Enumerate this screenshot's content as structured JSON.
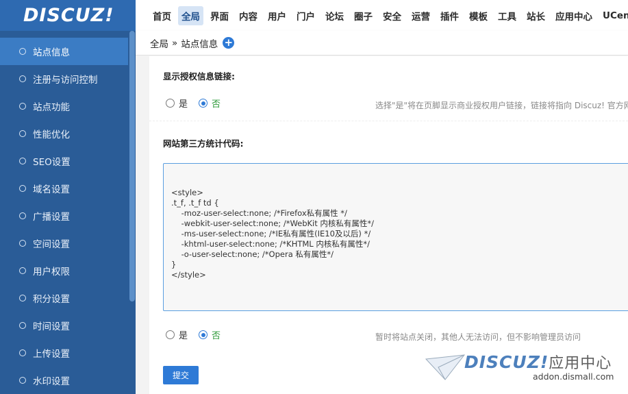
{
  "header": {
    "logo_text": "DISCUZ!",
    "nav": [
      "首页",
      "全局",
      "界面",
      "内容",
      "用户",
      "门户",
      "论坛",
      "圈子",
      "安全",
      "运营",
      "插件",
      "模板",
      "工具",
      "站长",
      "应用中心",
      "UCenter"
    ],
    "active_nav": "全局"
  },
  "sidebar": {
    "items": [
      {
        "label": "站点信息",
        "active": true
      },
      {
        "label": "注册与访问控制"
      },
      {
        "label": "站点功能"
      },
      {
        "label": "性能优化"
      },
      {
        "label": "SEO设置"
      },
      {
        "label": "域名设置"
      },
      {
        "label": "广播设置"
      },
      {
        "label": "空间设置"
      },
      {
        "label": "用户权限"
      },
      {
        "label": "积分设置"
      },
      {
        "label": "时间设置"
      },
      {
        "label": "上传设置"
      },
      {
        "label": "水印设置"
      }
    ]
  },
  "breadcrumb": {
    "root": "全局",
    "separator": "»",
    "current": "站点信息",
    "plus": "+"
  },
  "form": {
    "license_link": {
      "label": "显示授权信息链接:",
      "yes": "是",
      "no": "否",
      "selected": "否",
      "hint": "选择\"是\"将在页脚显示商业授权用户链接，链接将指向 Discuz! 官方网"
    },
    "stats_code": {
      "label": "网站第三方统计代码:",
      "value": "<style>\n.t_f, .t_f td {\n    -moz-user-select:none; /*Firefox私有属性 */\n    -webkit-user-select:none; /*WebKit 内核私有属性*/\n    -ms-user-select:none; /*IE私有属性(IE10及以后) */\n    -khtml-user-select:none; /*KHTML 内核私有属性*/\n    -o-user-select:none; /*Opera 私有属性*/\n}\n</style>"
    },
    "site_closed": {
      "yes": "是",
      "no": "否",
      "selected": "否",
      "hint": "暂时将站点关闭，其他人无法访问，但不影响管理员访问"
    },
    "submit_label": "提交"
  },
  "watermark": {
    "logo": "DISCUZ!",
    "cn": "应用中心",
    "url": "addon.dismall.com"
  },
  "colors": {
    "brand": "#2e6ab1",
    "sidebar": "#2a5c97",
    "sidebar_active": "#3b7cc4",
    "accent": "#2e7ad6"
  }
}
